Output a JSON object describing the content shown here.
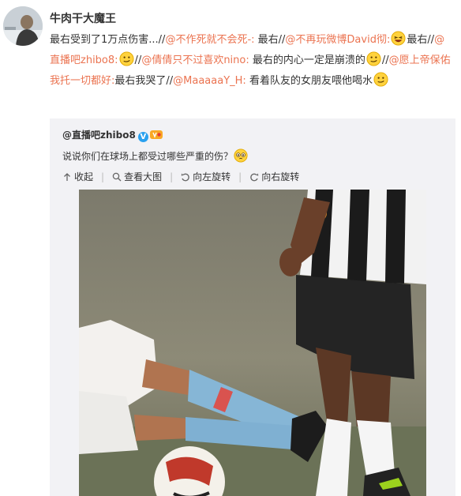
{
  "post": {
    "author_name": "牛肉干大魔王",
    "text_seg1": "最右受到了1万点伤害...//",
    "mention1": "@不作死就不会死-:",
    "text_seg2": " 最右//",
    "mention2": "@不再玩微博David彻:",
    "text_seg3": "最右//",
    "mention3": "@直播吧zhibo8:",
    "text_seg4": "//",
    "mention4": "@倩倩只不过喜欢nino:",
    "text_seg5": " 最右的内心一定是崩溃的",
    "text_seg6": "//",
    "mention5": "@愿上帝保佑我托一切都好:",
    "text_seg7": "最右我哭了//",
    "mention6": "@MaaaaaY_H:",
    "text_seg8": " 看着队友的女朋友喂他喝水"
  },
  "repost": {
    "author": "@直播吧zhibo8",
    "verified_badge": "V",
    "text": "说说你们在球场上都受过哪些严重的伤？",
    "actions": {
      "collapse": "收起",
      "view_large": "查看大图",
      "rotate_left": "向左旋转",
      "rotate_right": "向右旋转"
    }
  },
  "colors": {
    "link": "#eb7350",
    "repost_bg": "#f2f2f5",
    "verified": "#2aa1ef"
  },
  "icons": [
    "avatar-photo",
    "laughing-emoji",
    "smirk-emoji",
    "pleading-emoji",
    "verified-icon",
    "vip-icon",
    "collapse-icon",
    "search-icon",
    "rotate-left-icon",
    "rotate-right-icon"
  ]
}
